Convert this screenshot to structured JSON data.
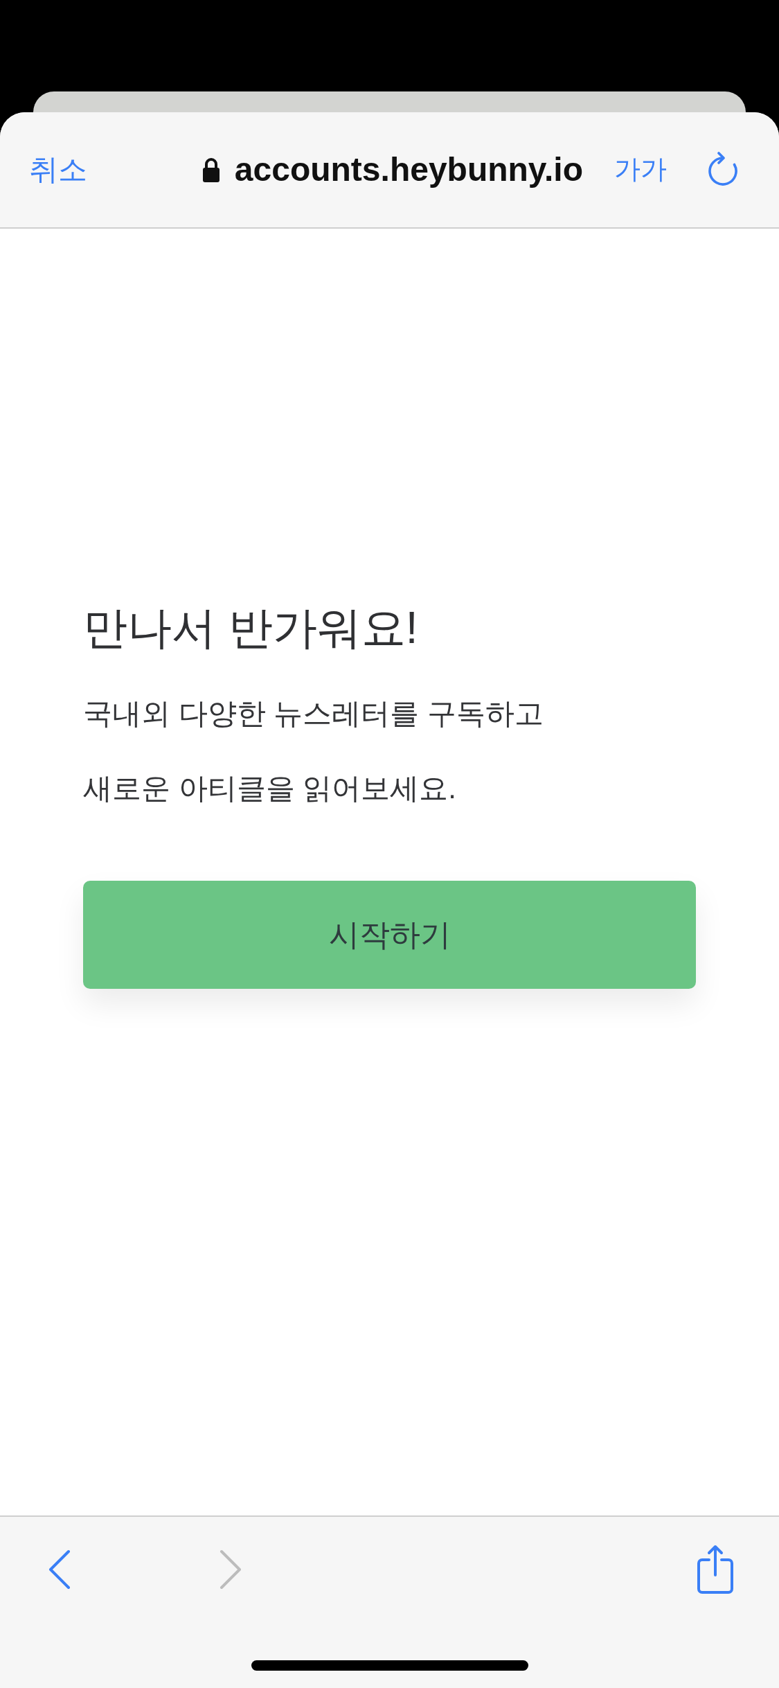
{
  "browser_bar": {
    "cancel_label": "취소",
    "secure": true,
    "url": "accounts.heybunny.io",
    "text_size_label": "가가"
  },
  "page": {
    "heading": "만나서 반가워요!",
    "description_lines": [
      "국내외 다양한 뉴스레터를 구독하고",
      "새로운 아티클을 읽어보세요."
    ],
    "start_button": "시작하기"
  },
  "toolbar": {
    "items": [
      {
        "kind": "back",
        "disabled": false
      },
      {
        "kind": "forward",
        "disabled": true
      },
      {
        "kind": "share",
        "disabled": false
      }
    ]
  }
}
